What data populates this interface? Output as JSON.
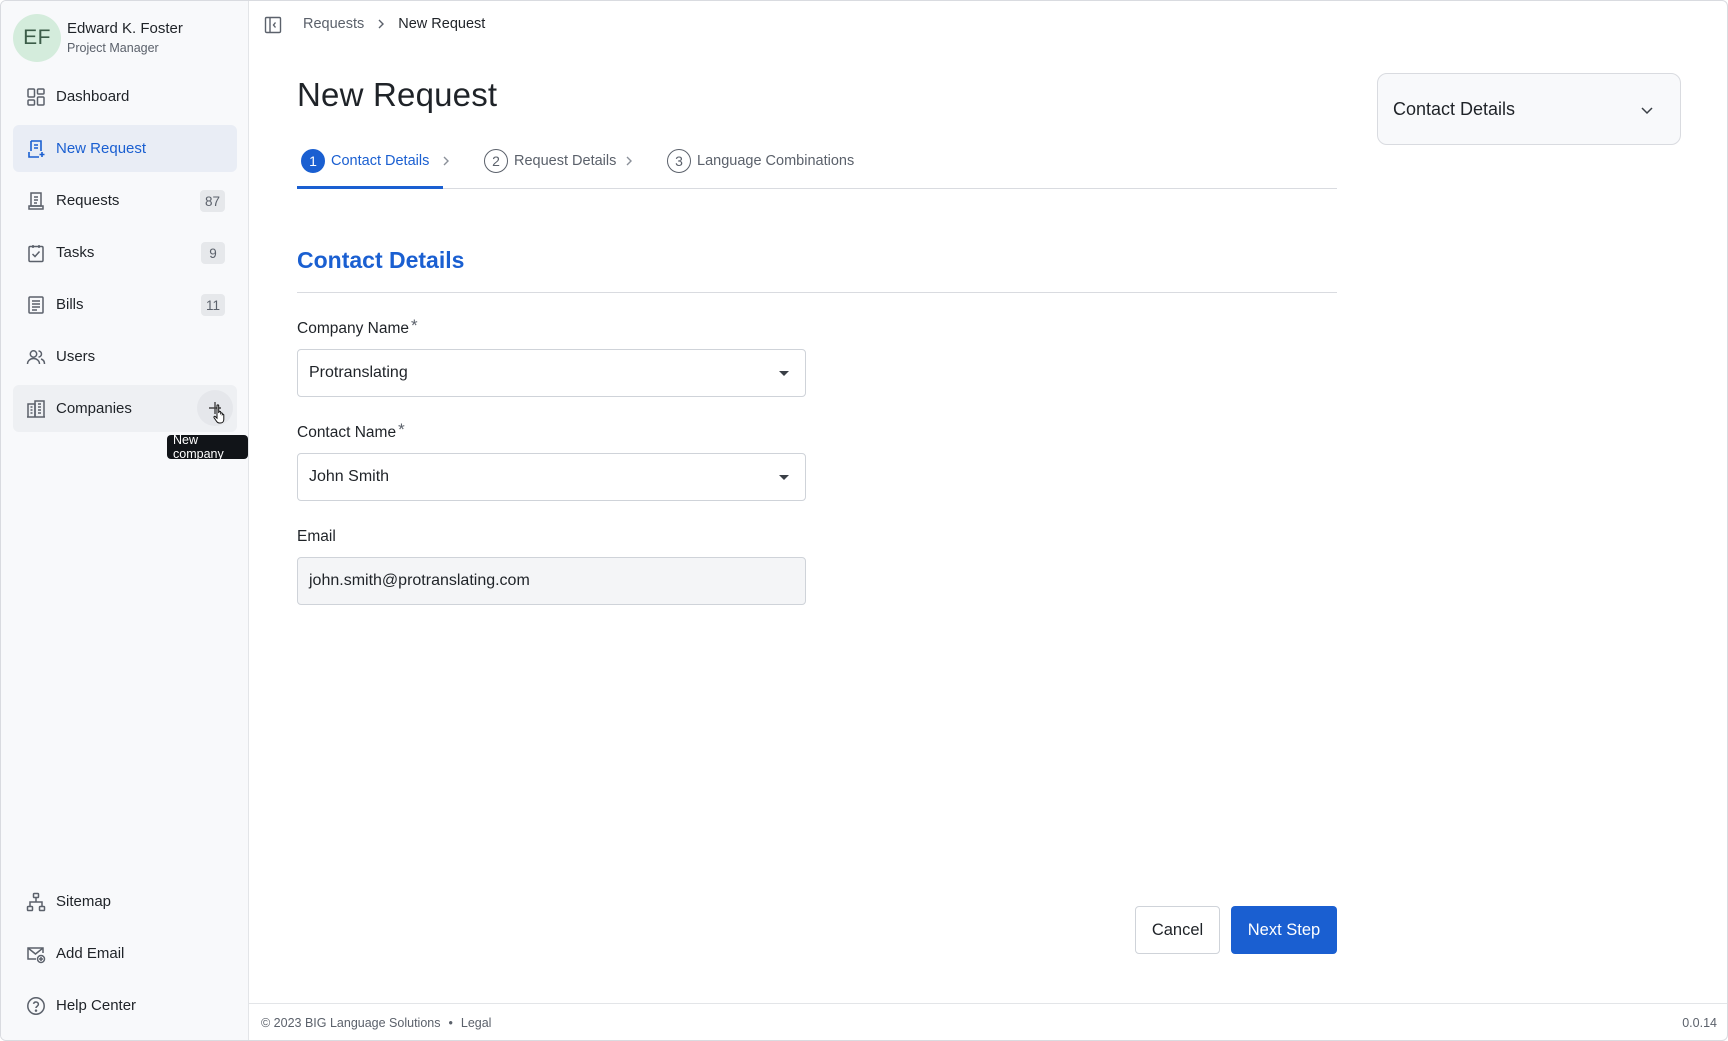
{
  "user": {
    "initials": "EF",
    "name": "Edward K. Foster",
    "role": "Project Manager"
  },
  "sidebar": {
    "items": [
      {
        "label": "Dashboard",
        "icon": "dashboard-icon"
      },
      {
        "label": "New Request",
        "icon": "new-request-icon",
        "active": true
      },
      {
        "label": "Requests",
        "icon": "requests-icon",
        "badge": "87"
      },
      {
        "label": "Tasks",
        "icon": "tasks-icon",
        "badge": "9"
      },
      {
        "label": "Bills",
        "icon": "bills-icon",
        "badge": "11"
      },
      {
        "label": "Users",
        "icon": "users-icon"
      },
      {
        "label": "Companies",
        "icon": "companies-icon"
      }
    ],
    "tooltip": "New company",
    "bottom_items": [
      {
        "label": "Sitemap",
        "icon": "sitemap-icon"
      },
      {
        "label": "Add Email",
        "icon": "add-email-icon"
      },
      {
        "label": "Help Center",
        "icon": "help-icon"
      }
    ]
  },
  "breadcrumb": {
    "parent": "Requests",
    "current": "New Request"
  },
  "page": {
    "title": "New Request"
  },
  "steps": [
    {
      "num": "1",
      "label": "Contact Details",
      "active": true
    },
    {
      "num": "2",
      "label": "Request Details"
    },
    {
      "num": "3",
      "label": "Language Combinations"
    }
  ],
  "form": {
    "section_title": "Contact Details",
    "company": {
      "label": "Company Name",
      "required_mark": "*",
      "value": "Protranslating"
    },
    "contact": {
      "label": "Contact Name",
      "required_mark": "*",
      "value": "John Smith"
    },
    "email": {
      "label": "Email",
      "value": "john.smith@protranslating.com"
    }
  },
  "actions": {
    "cancel": "Cancel",
    "next": "Next Step"
  },
  "side_panel": {
    "title": "Contact Details"
  },
  "footer": {
    "copyright": "© 2023 BIG Language Solutions",
    "separator": "•",
    "legal": "Legal",
    "version": "0.0.14"
  },
  "colors": {
    "accent": "#1a5fd1",
    "avatar_bg": "#d4ecdc"
  }
}
